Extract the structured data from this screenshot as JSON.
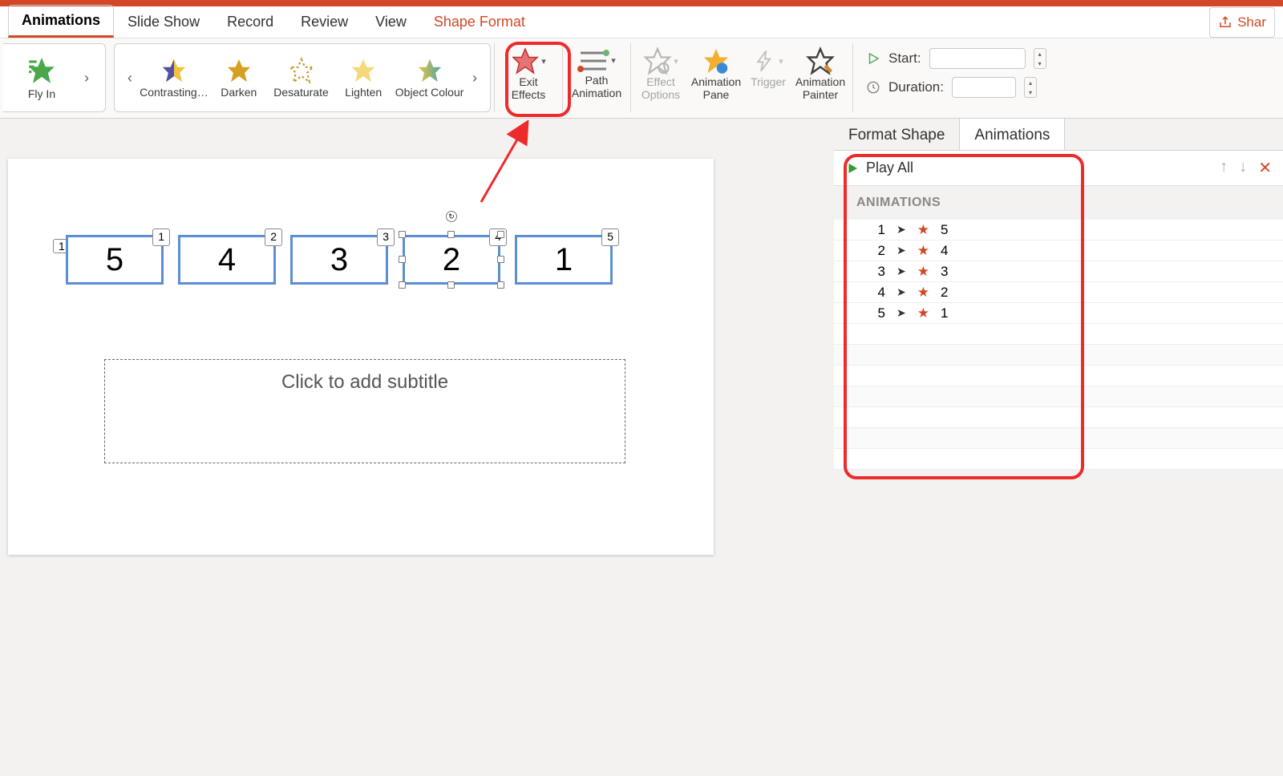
{
  "tabs": {
    "animations": "Animations",
    "slideshow": "Slide Show",
    "record": "Record",
    "review": "Review",
    "view": "View",
    "shapeformat": "Shape Format"
  },
  "share_label": "Shar",
  "ribbon": {
    "flyin": "Fly In",
    "emphasis": [
      "Contrasting…",
      "Darken",
      "Desaturate",
      "Lighten",
      "Object Colour"
    ],
    "exit": "Exit\nEffects",
    "path": "Path\nAnimation",
    "effect_options": "Effect\nOptions",
    "anim_pane": "Animation\nPane",
    "trigger": "Trigger",
    "anim_painter": "Animation\nPainter",
    "start_label": "Start:",
    "duration_label": "Duration:",
    "start_value": "",
    "duration_value": ""
  },
  "slide": {
    "index_tag": "1",
    "shapes": [
      {
        "tag": "1",
        "text": "5"
      },
      {
        "tag": "2",
        "text": "4"
      },
      {
        "tag": "3",
        "text": "3"
      },
      {
        "tag": "4",
        "text": "2"
      },
      {
        "tag": "5",
        "text": "1"
      }
    ],
    "subtitle_placeholder": "Click to add subtitle"
  },
  "right": {
    "tabs": {
      "format_shape": "Format Shape",
      "animations": "Animations"
    },
    "play_all": "Play All",
    "section": "ANIMATIONS",
    "items": [
      {
        "order": "1",
        "target": "5"
      },
      {
        "order": "2",
        "target": "4"
      },
      {
        "order": "3",
        "target": "3"
      },
      {
        "order": "4",
        "target": "2"
      },
      {
        "order": "5",
        "target": "1"
      }
    ]
  }
}
